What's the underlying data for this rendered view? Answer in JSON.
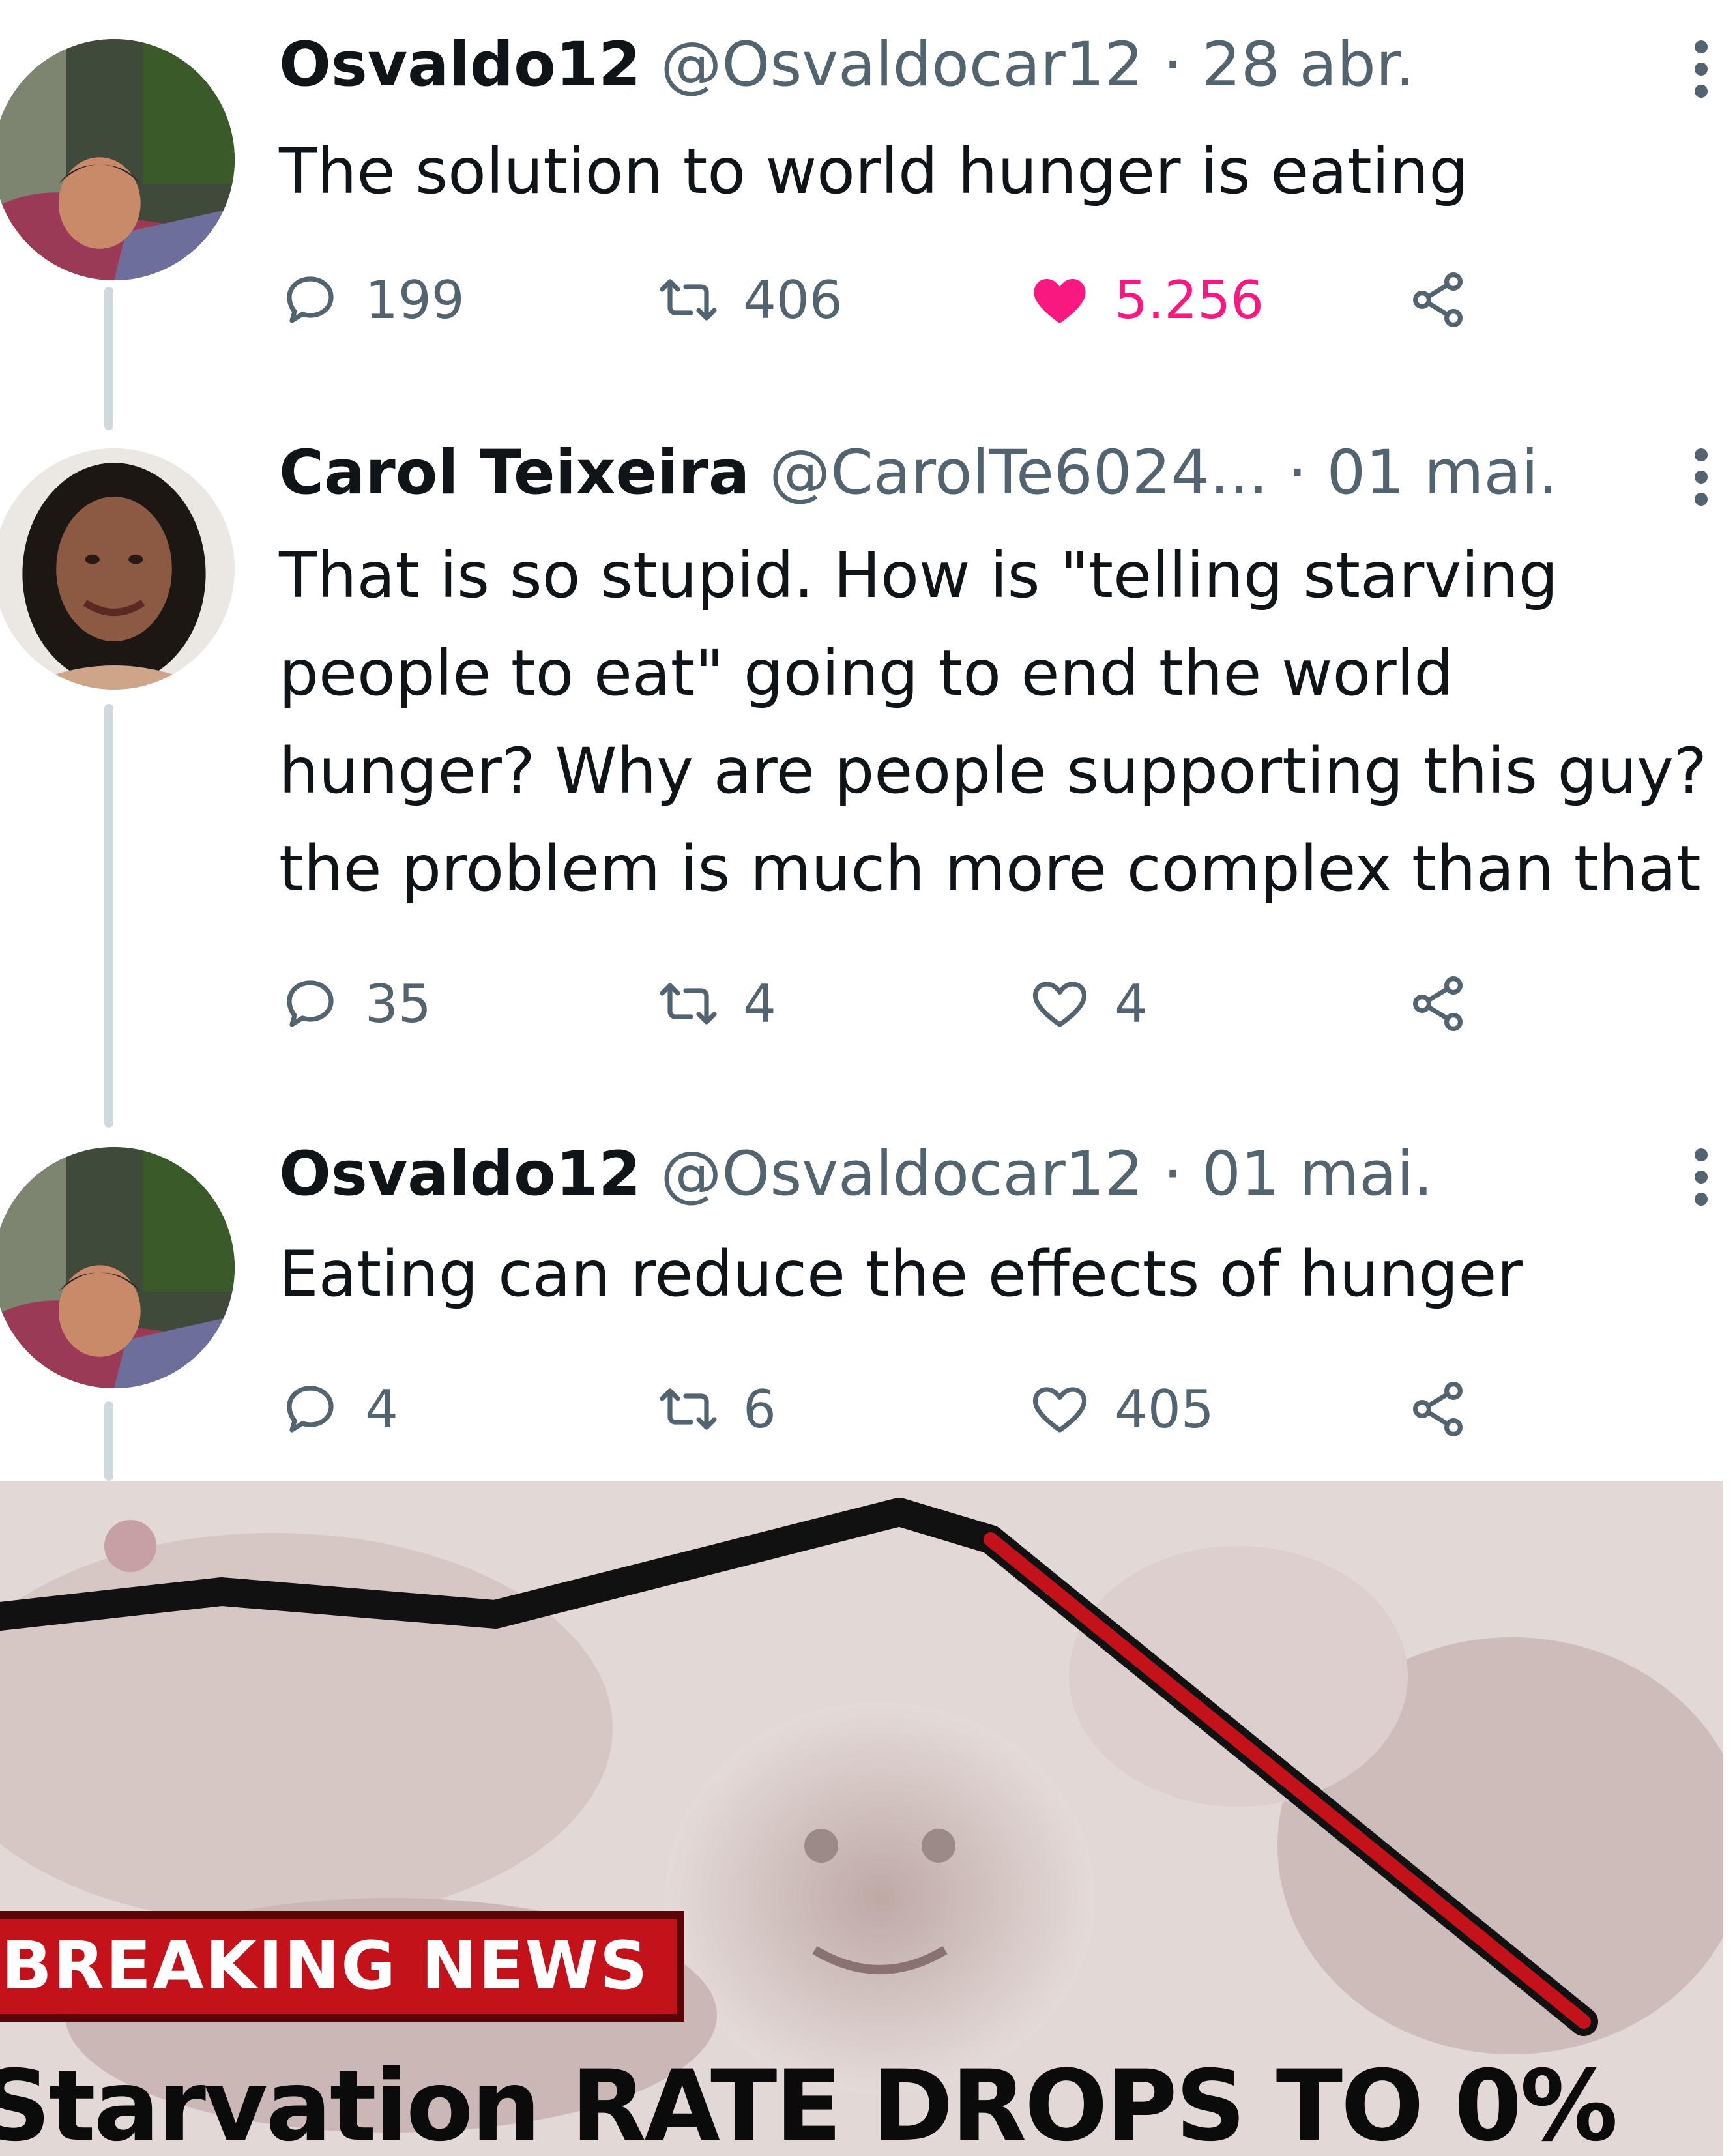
{
  "tweets": [
    {
      "name": "Osvaldo12",
      "handle": "@Osvaldocar12",
      "date": "28 abr.",
      "text_lines": [
        "The solution to world hunger is eating"
      ],
      "replies": "199",
      "retweets": "406",
      "likes": "5.256",
      "liked": true
    },
    {
      "name": "Carol Teixeira",
      "handle": "@CarolTe6024...",
      "date": "01 mai.",
      "text_lines": [
        "That is so stupid. How is \"telling starving",
        "people to eat\" going to end the world",
        "hunger? Why are people supporting this guy?",
        "the problem is much more complex than that"
      ],
      "replies": "35",
      "retweets": "4",
      "likes": "4",
      "liked": false
    },
    {
      "name": "Osvaldo12",
      "handle": "@Osvaldocar12",
      "date": "01 mai.",
      "text_lines": [
        "Eating can reduce the effects of hunger"
      ],
      "replies": "4",
      "retweets": "6",
      "likes": "405",
      "liked": false
    }
  ],
  "separator": "·",
  "meme": {
    "banner": "BREAKING NEWS",
    "headline": "Starvation RATE DROPS TO 0%"
  },
  "colors": {
    "like_active": "#f91880",
    "secondary_text": "#536471",
    "thread_line": "#cfd9de",
    "banner_red": "#c3121a"
  },
  "icons": {
    "reply": "reply-icon",
    "retweet": "retweet-icon",
    "like": "heart-icon",
    "share": "share-icon",
    "more": "more-icon"
  }
}
